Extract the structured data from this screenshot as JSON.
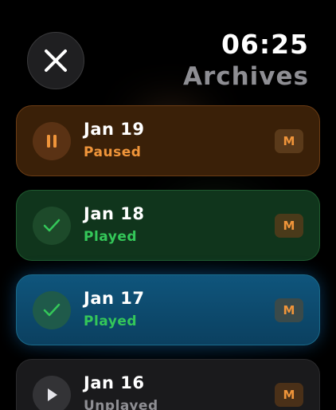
{
  "header": {
    "time": "06:25",
    "title": "Archives"
  },
  "colors": {
    "accent_orange": "#f0953a",
    "played_green": "#34c759",
    "unplayed_gray": "#8e8e93"
  },
  "archives": [
    {
      "date": "Jan 19",
      "status": "Paused",
      "status_icon": "pause-icon",
      "badge": "M"
    },
    {
      "date": "Jan 18",
      "status": "Played",
      "status_icon": "checkmark-icon",
      "badge": "M"
    },
    {
      "date": "Jan 17",
      "status": "Played",
      "status_icon": "checkmark-icon",
      "badge": "M"
    },
    {
      "date": "Jan 16",
      "status": "Unplayed",
      "status_icon": "play-icon",
      "badge": "M"
    }
  ]
}
